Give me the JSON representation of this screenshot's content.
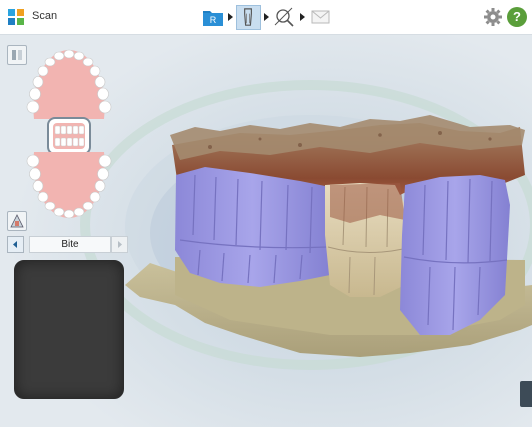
{
  "app": {
    "title": "Scan"
  },
  "workflow": {
    "steps": [
      {
        "name": "rx",
        "label": "R",
        "icon": "rx-folder-icon"
      },
      {
        "name": "scan",
        "icon": "tooth-scan-icon",
        "active": true
      },
      {
        "name": "view",
        "icon": "view-tools-icon"
      },
      {
        "name": "send",
        "icon": "envelope-icon"
      }
    ]
  },
  "toolbar": {
    "settings_icon": "gear-icon",
    "help_label": "?"
  },
  "segment": {
    "selected": "Bite"
  },
  "colors": {
    "accent": "#1f7fc3",
    "help": "#5a9e3a",
    "gum": "#f2b4b1",
    "tooth": "#ffffff",
    "scan_tooth": "#9a97e0",
    "scan_gum": "#8e5a3e",
    "preview_bg": "#3b3b3b"
  }
}
